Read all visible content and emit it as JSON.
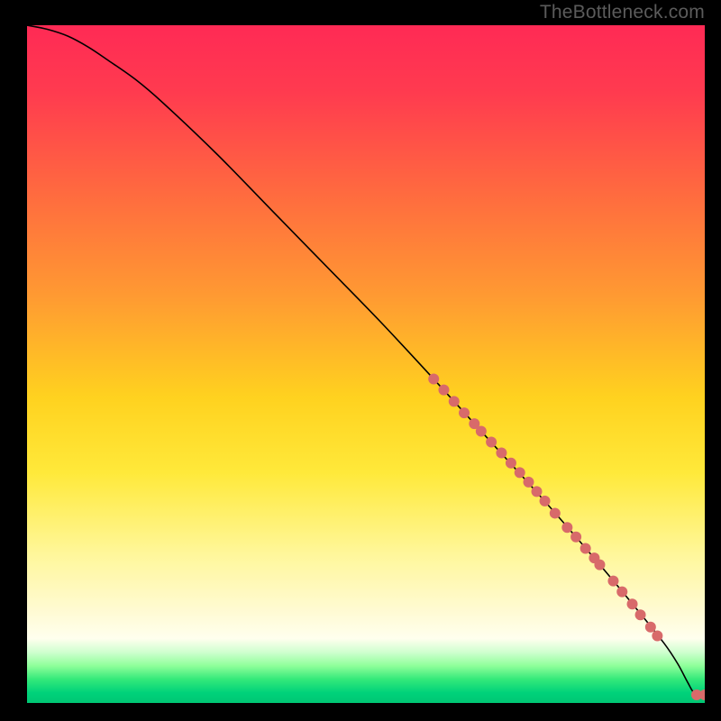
{
  "watermark": "TheBottleneck.com",
  "chart_data": {
    "type": "line",
    "title": "",
    "xlabel": "",
    "ylabel": "",
    "xlim": [
      0,
      100
    ],
    "ylim": [
      0,
      100
    ],
    "grid": false,
    "background_gradient_stops": [
      {
        "offset": 0.0,
        "color": "#ff2a55"
      },
      {
        "offset": 0.1,
        "color": "#ff3b4f"
      },
      {
        "offset": 0.25,
        "color": "#ff6b3f"
      },
      {
        "offset": 0.4,
        "color": "#ff9a32"
      },
      {
        "offset": 0.55,
        "color": "#ffd21f"
      },
      {
        "offset": 0.66,
        "color": "#ffe93a"
      },
      {
        "offset": 0.78,
        "color": "#fff79a"
      },
      {
        "offset": 0.86,
        "color": "#fffad0"
      },
      {
        "offset": 0.905,
        "color": "#ffffee"
      },
      {
        "offset": 0.925,
        "color": "#cfffcf"
      },
      {
        "offset": 0.945,
        "color": "#8fff9a"
      },
      {
        "offset": 0.965,
        "color": "#34e97a"
      },
      {
        "offset": 0.985,
        "color": "#00d27a"
      },
      {
        "offset": 1.0,
        "color": "#00c774"
      }
    ],
    "series": [
      {
        "name": "curve",
        "type": "line",
        "color": "#000000",
        "stroke_width": 1.6,
        "x": [
          0,
          3,
          6,
          9,
          12,
          16,
          20,
          28,
          36,
          44,
          52,
          60,
          68,
          76,
          84,
          90,
          94,
          96,
          97.5,
          98.5,
          100
        ],
        "y": [
          100,
          99.4,
          98.4,
          96.8,
          94.8,
          92.0,
          88.6,
          81.0,
          72.8,
          64.6,
          56.4,
          47.8,
          39.0,
          30.2,
          21.0,
          13.8,
          8.8,
          5.8,
          3.0,
          1.4,
          1.0
        ]
      },
      {
        "name": "points-on-curve",
        "type": "scatter",
        "color": "#d86a6a",
        "radius": 6,
        "points": [
          {
            "x": 60.0,
            "y": 47.8
          },
          {
            "x": 61.5,
            "y": 46.2
          },
          {
            "x": 63.0,
            "y": 44.5
          },
          {
            "x": 64.5,
            "y": 42.8
          },
          {
            "x": 66.0,
            "y": 41.2
          },
          {
            "x": 67.0,
            "y": 40.1
          },
          {
            "x": 68.5,
            "y": 38.5
          },
          {
            "x": 70.0,
            "y": 36.9
          },
          {
            "x": 71.4,
            "y": 35.4
          },
          {
            "x": 72.7,
            "y": 34.0
          },
          {
            "x": 74.0,
            "y": 32.6
          },
          {
            "x": 75.2,
            "y": 31.2
          },
          {
            "x": 76.4,
            "y": 29.8
          },
          {
            "x": 77.9,
            "y": 28.0
          },
          {
            "x": 79.7,
            "y": 25.9
          },
          {
            "x": 81.0,
            "y": 24.5
          },
          {
            "x": 82.4,
            "y": 22.8
          },
          {
            "x": 83.7,
            "y": 21.4
          },
          {
            "x": 84.5,
            "y": 20.4
          },
          {
            "x": 86.5,
            "y": 18.0
          },
          {
            "x": 87.8,
            "y": 16.4
          },
          {
            "x": 89.3,
            "y": 14.6
          },
          {
            "x": 90.5,
            "y": 13.0
          },
          {
            "x": 92.0,
            "y": 11.2
          },
          {
            "x": 93.0,
            "y": 9.9
          }
        ]
      },
      {
        "name": "points-flat",
        "type": "scatter",
        "color": "#d86a6a",
        "radius": 6,
        "points": [
          {
            "x": 98.8,
            "y": 1.2
          },
          {
            "x": 100.0,
            "y": 1.2
          }
        ]
      }
    ]
  }
}
